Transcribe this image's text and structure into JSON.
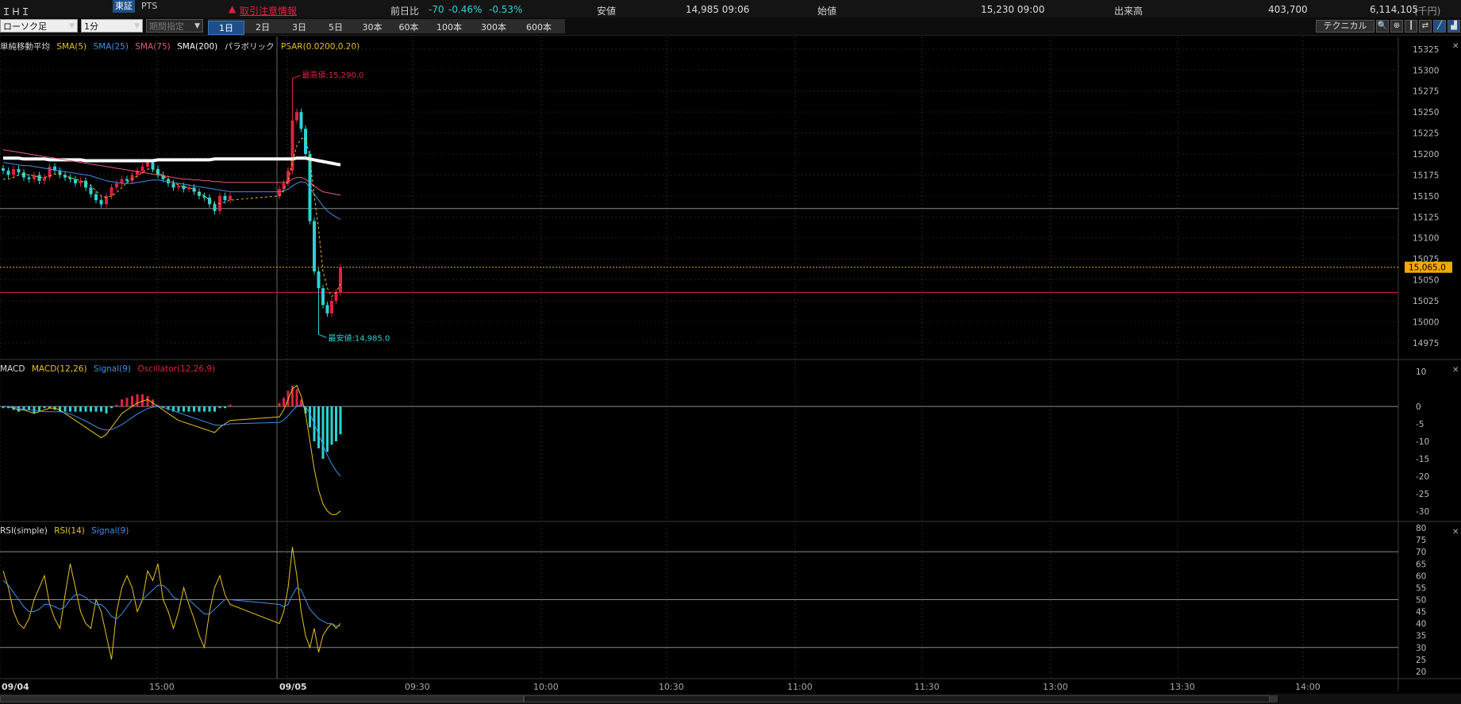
{
  "header": {
    "stock_name": "ＩＨＩ",
    "exchange": "東証",
    "pts": "PTS",
    "alert": "取引注意情報",
    "change_label": "前日比",
    "change_value": "-70",
    "change_pct1": "-0.46%",
    "change_pct2": "-0.53%",
    "low_label": "安値",
    "low_value": "14,985 09:06",
    "open_label": "始値",
    "open_value": "15,230 09:00",
    "volume_label": "出来高",
    "volume_value": "403,700",
    "turnover_value": "6,114,105",
    "turnover_unit": "(千円)"
  },
  "toolbar": {
    "chart_type": "ローソク足",
    "interval": "1分",
    "period": "期間指定",
    "ranges": [
      "1日",
      "2日",
      "3日",
      "5日",
      "30本",
      "60本",
      "100本",
      "300本",
      "600本"
    ],
    "active_range": "1日",
    "technical": "テクニカル"
  },
  "icons": [
    "search-icon",
    "zoom-icon",
    "candle-icon",
    "compare-icon",
    "draw-icon",
    "area-chart-icon",
    "bar-chart-icon"
  ],
  "colors": {
    "sma5": "#e6c21e",
    "sma25": "#3f8fe6",
    "sma75": "#e85a7a",
    "sma200": "#ffffff",
    "psar": "#e6c21e",
    "up": "#e0213f",
    "down": "#2bd3d3",
    "macd": "#e6c21e",
    "signal": "#3f8fe6",
    "osc_pos": "#e0213f",
    "osc_neg": "#2bd3d3",
    "rsi": "#e6c21e",
    "rsi_signal": "#3f8fe6",
    "price_tag": "#f2a900"
  },
  "main_legend": {
    "title": "単純移動平均",
    "sma5": "SMA(5)",
    "sma25": "SMA(25)",
    "sma75": "SMA(75)",
    "sma200": "SMA(200)",
    "psar_title": "パラボリック",
    "psar": "PSAR(0.0200,0.20)"
  },
  "macd_legend": {
    "title": "MACD",
    "macd": "MACD(12,26)",
    "signal": "Signal(9)",
    "osc": "Oscillator(12,26,9)"
  },
  "rsi_legend": {
    "title": "RSI(simple)",
    "rsi": "RSI(14)",
    "signal": "Signal(9)"
  },
  "chart_data": [
    {
      "type": "candlestick",
      "panel": "price",
      "yaxis_ticks": [
        15325,
        15300,
        15275,
        15250,
        15225,
        15200,
        15175,
        15150,
        15125,
        15100,
        15075,
        15050,
        15025,
        15000,
        14975
      ],
      "ylim": [
        14955,
        15340
      ],
      "current_price": "15,065.0",
      "current_price_value": 15065,
      "high_label": "最高値:15,290.0",
      "high_value": 15290,
      "low_label": "最安値:14,985.0",
      "low_value": 14985,
      "ref_lines": [
        15135,
        15035
      ],
      "x_labels": [
        "09/04",
        "15:00",
        "09/05",
        "09:30",
        "10:00",
        "10:30",
        "11:00",
        "11:30",
        "13:00",
        "13:30",
        "14:00"
      ],
      "series": {
        "close": [
          15180,
          15175,
          15182,
          15178,
          15172,
          15170,
          15175,
          15168,
          15172,
          15185,
          15180,
          15175,
          15172,
          15170,
          15165,
          15168,
          15160,
          15152,
          15145,
          15140,
          15150,
          15160,
          15165,
          15170,
          15168,
          15175,
          15180,
          15185,
          15190,
          15182,
          15175,
          15170,
          15165,
          15160,
          15162,
          15158,
          15160,
          15155,
          15150,
          15148,
          15140,
          15132,
          15150,
          15145,
          15150,
          15158,
          15165,
          15180,
          15240,
          15250,
          15230,
          15200,
          15120,
          15060,
          15040,
          15020,
          15010,
          15025,
          15035,
          15065
        ],
        "sma5": [
          15170,
          15170,
          15172,
          15175,
          15176,
          15175,
          15174,
          15172,
          15172,
          15174,
          15176,
          15176,
          15174,
          15172,
          15170,
          15168,
          15166,
          15162,
          15156,
          15150,
          15148,
          15150,
          15154,
          15160,
          15166,
          15170,
          15174,
          15178,
          15182,
          15182,
          15178,
          15174,
          15170,
          15166,
          15163,
          15161,
          15160,
          15158,
          15154,
          15150,
          15145,
          15140,
          15141,
          15143,
          15145,
          15150,
          15157,
          15168,
          15190,
          15210,
          15218,
          15220,
          15195,
          15150,
          15110,
          15060,
          15040,
          15030,
          15035,
          15045
        ],
        "sma25": [
          15190,
          15189,
          15188,
          15187,
          15186,
          15186,
          15185,
          15184,
          15183,
          15182,
          15181,
          15180,
          15179,
          15178,
          15177,
          15176,
          15175,
          15174,
          15172,
          15170,
          15168,
          15167,
          15166,
          15165,
          15165,
          15165,
          15166,
          15167,
          15168,
          15169,
          15169,
          15168,
          15167,
          15166,
          15165,
          15164,
          15163,
          15162,
          15161,
          15160,
          15159,
          15158,
          15157,
          15156,
          15155,
          15155,
          15156,
          15158,
          15162,
          15165,
          15167,
          15166,
          15160,
          15152,
          15145,
          15138,
          15132,
          15128,
          15125,
          15122
        ],
        "sma75": [
          15205,
          15204,
          15203,
          15202,
          15201,
          15200,
          15199,
          15198,
          15197,
          15196,
          15195,
          15194,
          15193,
          15192,
          15191,
          15190,
          15189,
          15188,
          15187,
          15186,
          15185,
          15184,
          15183,
          15182,
          15181,
          15180,
          15179,
          15178,
          15177,
          15176,
          15175,
          15174,
          15173,
          15172,
          15171,
          15170,
          15170,
          15169,
          15169,
          15168,
          15168,
          15167,
          15167,
          15166,
          15166,
          15166,
          15166,
          15167,
          15170,
          15172,
          15172,
          15170,
          15166,
          15162,
          15158,
          15155,
          15154,
          15153,
          15152,
          15151
        ],
        "sma200": [
          15195,
          15195,
          15195,
          15195,
          15194,
          15194,
          15194,
          15194,
          15194,
          15193,
          15193,
          15193,
          15193,
          15193,
          15193,
          15193,
          15192,
          15192,
          15192,
          15192,
          15192,
          15192,
          15192,
          15192,
          15192,
          15192,
          15192,
          15192,
          15192,
          15192,
          15193,
          15193,
          15193,
          15193,
          15193,
          15193,
          15193,
          15193,
          15193,
          15193,
          15193,
          15194,
          15194,
          15194,
          15194,
          15194,
          15194,
          15194,
          15194,
          15195,
          15195,
          15195,
          15194,
          15193,
          15192,
          15191,
          15190,
          15189,
          15188,
          15187
        ]
      }
    },
    {
      "type": "bar+line",
      "panel": "macd",
      "yaxis_ticks": [
        10,
        0,
        -5,
        -10,
        -15,
        -20,
        -25,
        -30
      ],
      "ylim": [
        -33,
        13
      ],
      "macd": [
        0,
        0,
        -0.5,
        -1,
        -1,
        -1.5,
        -2,
        -1.5,
        -1,
        -0.5,
        -0.5,
        -1,
        -2,
        -3,
        -4,
        -5,
        -6,
        -7,
        -8,
        -9,
        -8,
        -6,
        -4,
        -2,
        -1,
        0,
        1,
        1.5,
        2,
        1,
        0,
        -1,
        -2,
        -3,
        -4,
        -4.5,
        -5,
        -5.5,
        -6,
        -6.5,
        -7,
        -7.5,
        -6,
        -5,
        -4,
        -3,
        -1,
        2,
        5,
        6,
        3,
        -2,
        -10,
        -18,
        -24,
        -28,
        -30,
        -31,
        -31,
        -30
      ],
      "signal": [
        0,
        0,
        -0.2,
        -0.5,
        -0.8,
        -1,
        -1.2,
        -1.4,
        -1.5,
        -1.5,
        -1.5,
        -1.5,
        -1.8,
        -2.2,
        -2.8,
        -3.5,
        -4.2,
        -5,
        -5.8,
        -6.5,
        -6.8,
        -6.6,
        -6,
        -5.2,
        -4.2,
        -3.2,
        -2.2,
        -1.4,
        -0.6,
        -0.2,
        0,
        -0.3,
        -0.7,
        -1.2,
        -1.8,
        -2.3,
        -2.8,
        -3.3,
        -3.8,
        -4.3,
        -4.8,
        -5.3,
        -5.4,
        -5.3,
        -5,
        -4.6,
        -3.9,
        -2.7,
        -1.2,
        0,
        0.5,
        0,
        -2,
        -5,
        -8,
        -11,
        -14,
        -16.5,
        -18.5,
        -20
      ],
      "oscillator": [
        -0.5,
        -0.5,
        -1,
        -1.5,
        -1,
        -1,
        -2,
        -1.5,
        -0.5,
        -0.5,
        -1,
        -1.5,
        -1.5,
        -1.5,
        -1.5,
        -1.5,
        -1.5,
        -1.5,
        -1.5,
        -1.5,
        -2,
        -0.5,
        0.5,
        2,
        2.5,
        3,
        3.5,
        3.5,
        3,
        2,
        0.5,
        -0.5,
        -1,
        -1.5,
        -1.5,
        -1.5,
        -1.5,
        -1.5,
        -1.5,
        -1.5,
        -1.5,
        -1.5,
        -0.5,
        -0.5,
        0.5,
        1,
        2.5,
        4.5,
        6,
        5,
        2,
        -2,
        -6,
        -10,
        -12,
        -15,
        -13,
        -11,
        -10,
        -8
      ]
    },
    {
      "type": "line",
      "panel": "rsi",
      "yaxis_ticks": [
        80,
        75,
        70,
        65,
        60,
        55,
        50,
        45,
        40,
        35,
        30,
        25,
        20
      ],
      "ylim": [
        17,
        82
      ],
      "ref_lines": [
        70,
        50,
        30
      ],
      "rsi": [
        62,
        55,
        45,
        40,
        38,
        42,
        50,
        55,
        60,
        48,
        42,
        38,
        52,
        65,
        55,
        45,
        40,
        38,
        50,
        45,
        35,
        25,
        45,
        55,
        60,
        55,
        45,
        50,
        62,
        58,
        65,
        50,
        45,
        38,
        45,
        55,
        48,
        42,
        35,
        30,
        45,
        55,
        60,
        52,
        48,
        40,
        45,
        55,
        72,
        60,
        45,
        35,
        30,
        38,
        28,
        35,
        38,
        40,
        38,
        40
      ],
      "signal": [
        58,
        56,
        53,
        50,
        47,
        45,
        45,
        46,
        48,
        48,
        47,
        46,
        47,
        50,
        52,
        52,
        51,
        49,
        48,
        48,
        46,
        43,
        42,
        44,
        47,
        50,
        50,
        50,
        52,
        54,
        56,
        56,
        54,
        51,
        50,
        50,
        50,
        48,
        46,
        44,
        44,
        46,
        48,
        50,
        50,
        48,
        47,
        48,
        52,
        55,
        54,
        50,
        46,
        44,
        42,
        41,
        40,
        40,
        39,
        39
      ]
    }
  ]
}
